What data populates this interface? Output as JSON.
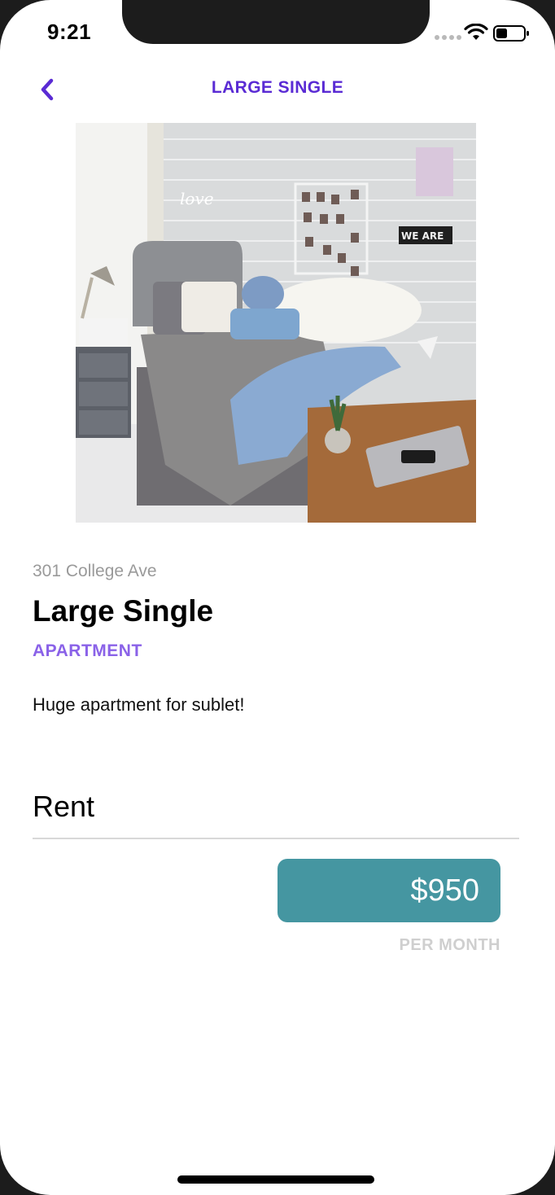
{
  "status_bar": {
    "time": "9:21"
  },
  "nav": {
    "title": "LARGE SINGLE",
    "back_icon": "chevron-left-icon"
  },
  "listing": {
    "address": "301 College Ave",
    "title": "Large Single",
    "type": "APARTMENT",
    "description": "Huge apartment for sublet!",
    "photo_sign_text": "WE ARE"
  },
  "rent": {
    "label": "Rent",
    "price": "$950",
    "period": "PER MONTH"
  },
  "colors": {
    "accent": "#5a2bd4",
    "type_label": "#8a62e8",
    "price_box": "#4596a1",
    "muted": "#9a9a9a"
  }
}
